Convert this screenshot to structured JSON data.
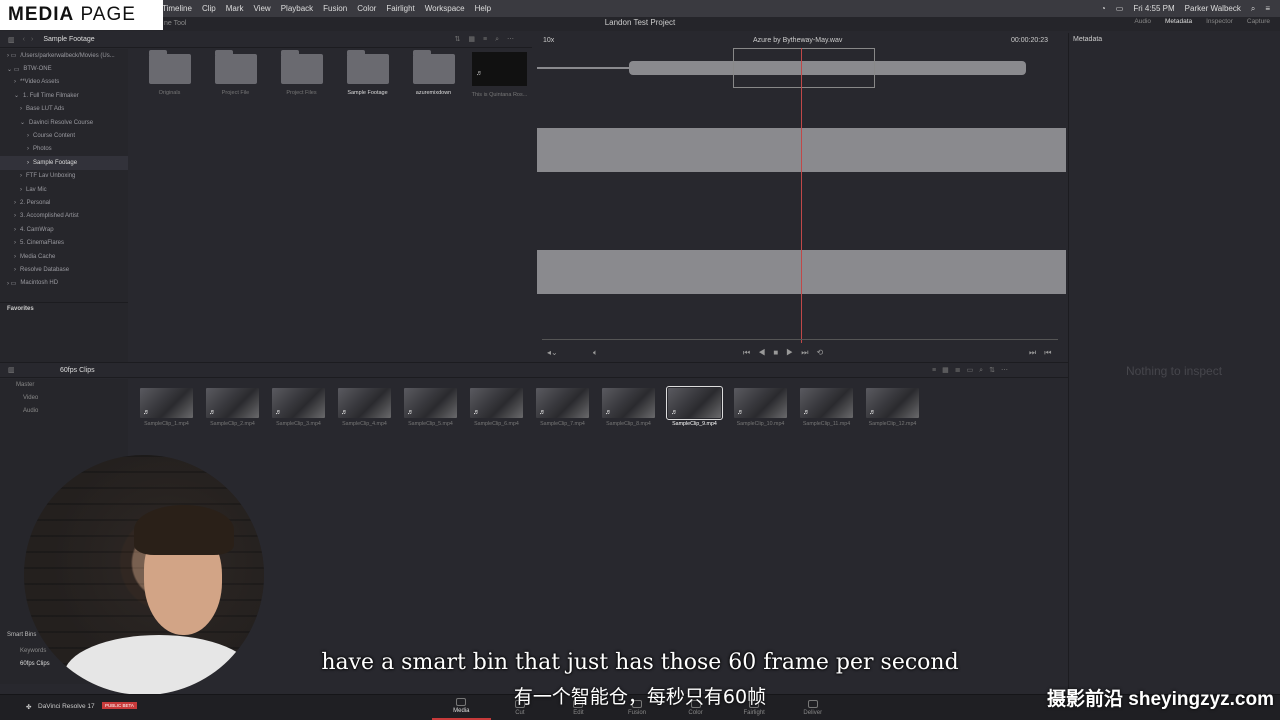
{
  "badge": {
    "bold": "MEDIA",
    "light": " PAGE"
  },
  "menubar": {
    "items": [
      "Timeline",
      "Clip",
      "Mark",
      "View",
      "Playback",
      "Fusion",
      "Color",
      "Fairlight",
      "Workspace",
      "Help"
    ],
    "clock": "Fri 4:55 PM",
    "user": "Parker Walbeck"
  },
  "toolbar": {
    "left_label": "ne Tool",
    "project": "Landon Test Project",
    "right": [
      "Audio",
      "Metadata",
      "Inspector",
      "Capture"
    ]
  },
  "browser": {
    "title": "Sample Footage",
    "tree": [
      "/Users/parkerwalbeck/Movies (Us...",
      "BTW-ONE",
      "**Video Assets",
      "1. Full Time Filmaker",
      "Base LUT Ads",
      "Davinci Resolve Course",
      "Course Content",
      "Photos",
      "Sample Footage",
      "FTF Lav Unboxing",
      "Lav Mic",
      "2. Personal",
      "3. Accomplished Artist",
      "4. CamWrap",
      "5. CinemaFlares",
      "Media Cache",
      "Resolve Database",
      "Macintosh HD"
    ],
    "favorites": "Favorites",
    "folders": [
      "Originals",
      "Project File",
      "Project Files",
      "Sample Footage",
      "azuremixdown",
      "This is Quintana Ros..."
    ]
  },
  "viewer": {
    "zoom": "10x",
    "clip": "Azure by Bytheway-May.wav",
    "timecode": "00:00:20:23"
  },
  "inspector": {
    "title": "Metadata",
    "empty": "Nothing to inspect"
  },
  "pool": {
    "title": "60fps Clips",
    "tree": [
      "Master",
      "Video",
      "Audio"
    ],
    "clips": [
      "SampleClip_1.mp4",
      "SampleClip_2.mp4",
      "SampleClip_3.mp4",
      "SampleClip_4.mp4",
      "SampleClip_5.mp4",
      "SampleClip_6.mp4",
      "SampleClip_7.mp4",
      "SampleClip_8.mp4",
      "SampleClip_9.mp4",
      "SampleClip_10.mp4",
      "SampleClip_11.mp4",
      "SampleClip_12.mp4"
    ],
    "smart_bins": {
      "title": "Smart Bins",
      "items": [
        "Keywords",
        "60fps Clips"
      ]
    }
  },
  "app": {
    "name": "DaVinci Resolve 17",
    "beta": "PUBLIC BETA"
  },
  "pages": [
    "Media",
    "Cut",
    "Edit",
    "Fusion",
    "Color",
    "Fairlight",
    "Deliver"
  ],
  "subtitles": {
    "en": "have a smart bin that just has those 60 frame per second",
    "cn": "有一个智能仓，每秒只有60帧"
  },
  "watermark": "摄影前沿 sheyingzyz.com"
}
